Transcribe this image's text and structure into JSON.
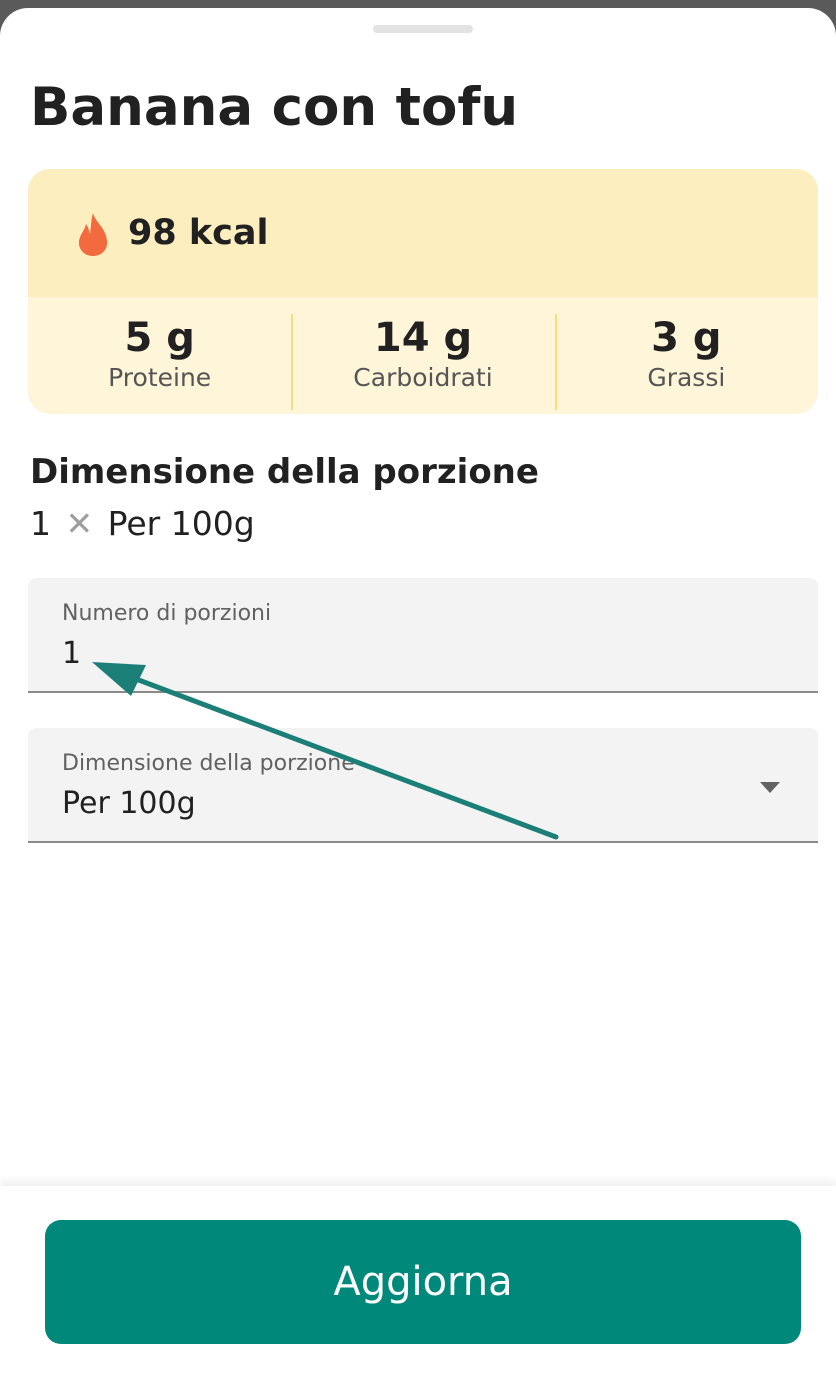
{
  "food": {
    "title": "Banana con tofu"
  },
  "nutrition": {
    "kcal": "98 kcal",
    "macros": [
      {
        "value": "5 g",
        "label": "Proteine"
      },
      {
        "value": "14 g",
        "label": "Carboidrati"
      },
      {
        "value": "3 g",
        "label": "Grassi"
      }
    ]
  },
  "portion": {
    "heading": "Dimensione della porzione",
    "count": "1",
    "times_symbol": "✕",
    "size": "Per 100g"
  },
  "fields": {
    "servings": {
      "label": "Numero di porzioni",
      "value": "1"
    },
    "size": {
      "label": "Dimensione della porzione",
      "value": "Per 100g",
      "icon": "dropdown-arrow-icon"
    }
  },
  "button": {
    "label": "Aggiorna"
  },
  "colors": {
    "accent": "#00897b",
    "flame": "#f26a3d",
    "card_top": "#fdeec0",
    "card_bottom": "#fff6da",
    "annotation_arrow": "#1c7f77"
  },
  "icons": {
    "calories": "flame-icon"
  }
}
